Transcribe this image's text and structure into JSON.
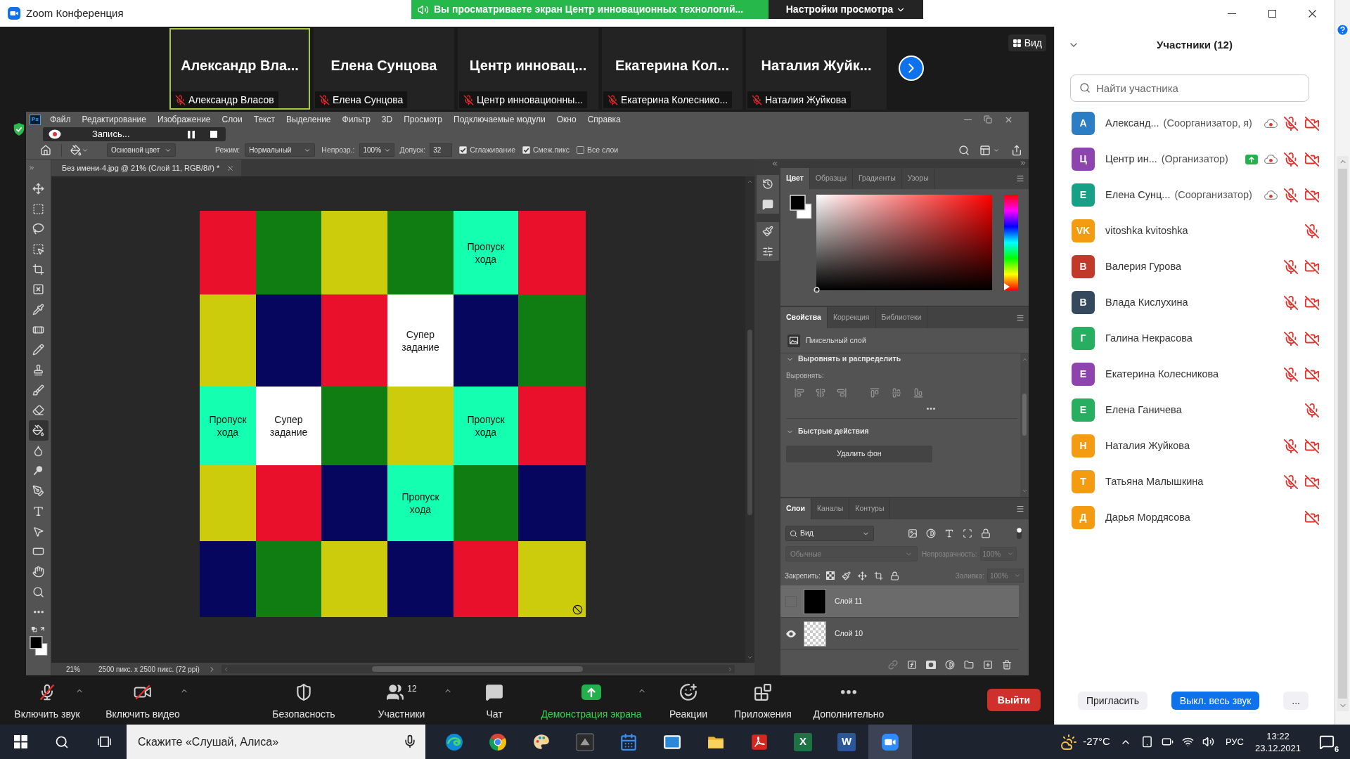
{
  "window": {
    "title": "Zoom Конференция"
  },
  "share_banner": {
    "text": "Вы просматриваете экран Центр инновационных технологий...",
    "settings_label": "Настройки просмотра"
  },
  "thumbnails": [
    {
      "display_name": "Александр Вла...",
      "label": "Александр Власов",
      "speaking": true,
      "muted": true
    },
    {
      "display_name": "Елена Сунцова",
      "label": "Елена Сунцова",
      "speaking": false,
      "muted": true
    },
    {
      "display_name": "Центр инновац...",
      "label": "Центр инновационны...",
      "speaking": false,
      "muted": true
    },
    {
      "display_name": "Екатерина Кол...",
      "label": "Екатерина Колеснико...",
      "speaking": false,
      "muted": true
    },
    {
      "display_name": "Наталия Жуйк...",
      "label": "Наталия Жуйкова",
      "speaking": false,
      "muted": true
    }
  ],
  "view_button": {
    "label": "Вид"
  },
  "recording": {
    "label": "Запись..."
  },
  "photoshop": {
    "app_badge": "Ps",
    "menu": [
      "Файл",
      "Редактирование",
      "Изображение",
      "Слои",
      "Текст",
      "Выделение",
      "Фильтр",
      "3D",
      "Просмотр",
      "Подключаемые модули",
      "Окно",
      "Справка"
    ],
    "options": {
      "fill_source": "Основной цвет",
      "mode_label": "Режим:",
      "mode": "Нормальный",
      "opacity_label": "Непрозр.:",
      "opacity": "100%",
      "tolerance_label": "Допуск:",
      "tolerance": "32",
      "checkboxes": [
        {
          "label": "Сглаживание",
          "checked": true
        },
        {
          "label": "Смеж.пикс",
          "checked": true
        },
        {
          "label": "Все слои",
          "checked": false
        }
      ]
    },
    "tools": [
      {
        "kind": "move",
        "selected": false
      },
      {
        "kind": "marquee",
        "selected": false
      },
      {
        "kind": "lasso",
        "selected": false
      },
      {
        "kind": "object_select",
        "selected": false
      },
      {
        "kind": "crop",
        "selected": false
      },
      {
        "kind": "frame",
        "selected": false
      },
      {
        "kind": "eyedropper",
        "selected": false
      },
      {
        "kind": "healing",
        "selected": false
      },
      {
        "kind": "pencil",
        "selected": false
      },
      {
        "kind": "stamp",
        "selected": false
      },
      {
        "kind": "history_brush",
        "selected": false
      },
      {
        "kind": "eraser",
        "selected": false
      },
      {
        "kind": "bucket",
        "selected": true
      },
      {
        "kind": "blur",
        "selected": false
      },
      {
        "kind": "dodge",
        "selected": false
      },
      {
        "kind": "pen",
        "selected": false
      },
      {
        "kind": "type",
        "selected": false
      },
      {
        "kind": "path_select",
        "selected": false
      },
      {
        "kind": "rectangle",
        "selected": false
      },
      {
        "kind": "hand",
        "selected": false
      },
      {
        "kind": "zoom",
        "selected": false
      },
      {
        "kind": "more",
        "selected": false
      }
    ],
    "document_tab": "Без имени-4.jpg @ 21% (Слой 11, RGB/8#) *",
    "canvas": {
      "rows": [
        [
          {
            "color": "#e8102a"
          },
          {
            "color": "#0f7d12"
          },
          {
            "color": "#cccc0c"
          },
          {
            "color": "#0f7d12"
          },
          {
            "color": "#15ffb0",
            "text": "Пропуск хода"
          },
          {
            "color": "#e8102a"
          }
        ],
        [
          {
            "color": "#cccc0c"
          },
          {
            "color": "#06065e"
          },
          {
            "color": "#e8102a"
          },
          {
            "color": "#ffffff",
            "text": "Супер задание"
          },
          {
            "color": "#06065e"
          },
          {
            "color": "#0f7d12"
          }
        ],
        [
          {
            "color": "#15ffb0",
            "text": "Пропуск хода"
          },
          {
            "color": "#ffffff",
            "text": "Супер задание"
          },
          {
            "color": "#0f7d12"
          },
          {
            "color": "#cccc0c"
          },
          {
            "color": "#15ffb0",
            "text": "Пропуск хода"
          },
          {
            "color": "#e8102a"
          }
        ],
        [
          {
            "color": "#cccc0c"
          },
          {
            "color": "#e8102a"
          },
          {
            "color": "#06065e"
          },
          {
            "color": "#15ffb0",
            "text": "Пропуск хода"
          },
          {
            "color": "#0f7d12"
          },
          {
            "color": "#06065e"
          }
        ],
        [
          {
            "color": "#06065e"
          },
          {
            "color": "#0f7d12"
          },
          {
            "color": "#cccc0c"
          },
          {
            "color": "#06065e"
          },
          {
            "color": "#e8102a"
          },
          {
            "color": "#cccc0c"
          }
        ]
      ]
    },
    "status": {
      "zoom": "21%",
      "size": "2500 пикс. x 2500 пикс. (72 ppi)"
    },
    "color_panel": {
      "tabs": [
        {
          "label": "Цвет",
          "selected": true
        },
        {
          "label": "Образцы",
          "selected": false
        },
        {
          "label": "Градиенты",
          "selected": false
        },
        {
          "label": "Узоры",
          "selected": false
        }
      ],
      "hue": {
        "level": 0
      }
    },
    "properties_panel": {
      "tabs": [
        {
          "label": "Свойства",
          "selected": true
        },
        {
          "label": "Коррекция",
          "selected": false
        },
        {
          "label": "Библиотеки",
          "selected": false
        }
      ],
      "layer_type": "Пиксельный слой",
      "sections": [
        {
          "title": "Выровнять и распределить",
          "expanded": true
        },
        {
          "title": "Быстрые действия",
          "expanded": true
        }
      ],
      "align_label": "Выровнять:",
      "remove_bg_button": "Удалить фон"
    },
    "layers_panel": {
      "tabs": [
        {
          "label": "Слои",
          "selected": true
        },
        {
          "label": "Каналы",
          "selected": false
        },
        {
          "label": "Контуры",
          "selected": false
        }
      ],
      "filter": "Вид",
      "filter_toggle": {
        "on": true
      },
      "blend": {
        "value": "Обычные",
        "disabled": true
      },
      "opacity": {
        "label": "Непрозрачность:",
        "value": "100%",
        "disabled": true
      },
      "lock_label": "Закрепить:",
      "fill": {
        "label": "Заливка:",
        "value": "100%",
        "disabled": true
      },
      "layers": [
        {
          "name": "Слой 11",
          "selected": true,
          "visible": false,
          "kind": "filled"
        },
        {
          "name": "Слой 10",
          "selected": false,
          "visible": true,
          "kind": "transparent"
        }
      ]
    }
  },
  "toolbar": {
    "items": [
      {
        "kind": "audio",
        "label": "Включить звук",
        "off": true,
        "caret": true,
        "active": false
      },
      {
        "kind": "video",
        "label": "Включить видео",
        "off": true,
        "caret": true,
        "active": false
      },
      {
        "kind": "security",
        "label": "Безопасность",
        "caret": false,
        "active": false
      },
      {
        "kind": "participants",
        "label": "Участники",
        "count": "12",
        "caret": true,
        "active": false
      },
      {
        "kind": "chat",
        "label": "Чат",
        "caret": false,
        "active": false
      },
      {
        "kind": "share",
        "label": "Демонстрация экрана",
        "caret": true,
        "active": true
      },
      {
        "kind": "reactions",
        "label": "Реакции",
        "caret": false,
        "active": false
      },
      {
        "kind": "apps",
        "label": "Приложения",
        "caret": false,
        "active": false
      },
      {
        "kind": "more",
        "label": "Дополнительно",
        "caret": false,
        "active": false
      }
    ],
    "leave": "Выйти"
  },
  "participants_panel": {
    "title": "Участники (12)",
    "search": {
      "placeholder": "Найти участника"
    },
    "participants": [
      {
        "name": "Александ...",
        "role": "(Соорганизатор, я)",
        "initial": "А",
        "color": "#2b7ec4",
        "sharing": false,
        "recording": true,
        "mic_off": true,
        "video_off": true
      },
      {
        "name": "Центр ин...",
        "role": "(Организатор)",
        "initial": "Ц",
        "color": "#8e44ad",
        "sharing": true,
        "recording": true,
        "mic_off": true,
        "video_off": true
      },
      {
        "name": "Елена Сунц...",
        "role": "(Соорганизатор)",
        "initial": "Е",
        "color": "#16a085",
        "sharing": false,
        "recording": true,
        "mic_off": true,
        "video_off": true
      },
      {
        "name": "vitoshka kvitoshka",
        "initial": "VK",
        "color": "#f39c12",
        "sharing": false,
        "recording": false,
        "mic_off": true,
        "video_off": false
      },
      {
        "name": "Валерия Гурова",
        "initial": "В",
        "color": "#c0392b",
        "sharing": false,
        "recording": false,
        "mic_off": true,
        "video_off": true
      },
      {
        "name": "Влада Кислухина",
        "initial": "В",
        "color": "#34495e",
        "sharing": false,
        "recording": false,
        "mic_off": true,
        "video_off": true
      },
      {
        "name": "Галина Некрасова",
        "initial": "Г",
        "color": "#27ae60",
        "sharing": false,
        "recording": false,
        "mic_off": true,
        "video_off": true
      },
      {
        "name": "Екатерина Колесникова",
        "initial": "Е",
        "color": "#8e44ad",
        "sharing": false,
        "recording": false,
        "mic_off": true,
        "video_off": true
      },
      {
        "name": "Елена Ганичева",
        "initial": "Е",
        "color": "#27ae60",
        "sharing": false,
        "recording": false,
        "mic_off": true,
        "video_off": false
      },
      {
        "name": "Наталия Жуйкова",
        "initial": "Н",
        "color": "#f39c12",
        "sharing": false,
        "recording": false,
        "mic_off": true,
        "video_off": true
      },
      {
        "name": "Татьяна Малышкина",
        "initial": "Т",
        "color": "#f39c12",
        "sharing": false,
        "recording": false,
        "mic_off": true,
        "video_off": true
      },
      {
        "name": "Дарья Мордясова",
        "initial": "Д",
        "color": "#f39c12",
        "sharing": false,
        "recording": false,
        "mic_off": false,
        "video_off": true
      }
    ],
    "buttons": [
      {
        "kind": "invite",
        "label": "Пригласить"
      },
      {
        "kind": "mute_all",
        "label": "Выкл. весь звук"
      },
      {
        "kind": "more",
        "label": "..."
      }
    ]
  },
  "taskbar": {
    "search": {
      "placeholder": "Скажите «Слушай, Алиса»"
    },
    "apps": [
      {
        "kind": "edge",
        "active": false
      },
      {
        "kind": "chrome",
        "active": false
      },
      {
        "kind": "paint",
        "active": false
      },
      {
        "kind": "tile",
        "active": false
      },
      {
        "kind": "calendar",
        "active": false
      },
      {
        "kind": "mail",
        "active": false
      },
      {
        "kind": "explorer",
        "active": false
      },
      {
        "kind": "acrobat",
        "active": false
      },
      {
        "kind": "excel",
        "letter": "X",
        "active": false
      },
      {
        "kind": "word",
        "letter": "W",
        "active": false
      },
      {
        "kind": "zoom",
        "active": true
      }
    ],
    "weather": "-27°C",
    "language": "РУС",
    "time": "13:22",
    "date": "23.12.2021",
    "notifications": "6"
  }
}
